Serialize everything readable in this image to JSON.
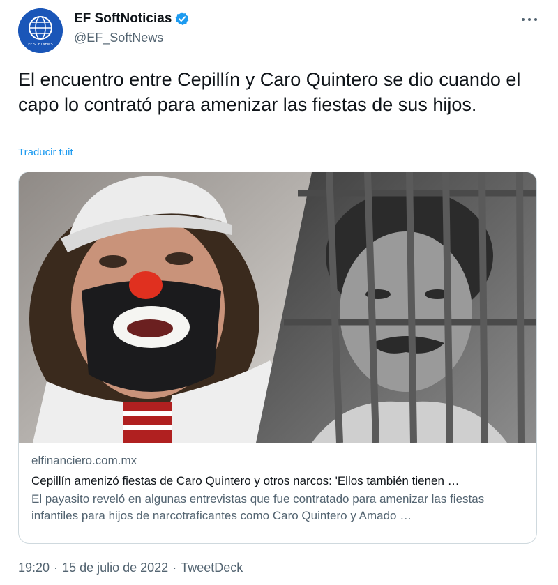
{
  "author": {
    "display_name": "EF SoftNoticias",
    "handle": "@EF_SoftNews",
    "avatar_icon": "globe-logo-icon",
    "avatar_text": "EF SOFTNEWS",
    "verified_icon": "verified-badge-icon"
  },
  "tweet": {
    "text": "El encuentro entre Cepillín y Caro Quintero se dio cuando el capo lo contrató para amenizar las fiestas de sus hijos.",
    "translate_label": "Traducir tuit"
  },
  "card": {
    "domain": "elfinanciero.com.mx",
    "title": "Cepillín amenizó fiestas de Caro Quintero y otros narcos: 'Ellos también tienen …",
    "description": "El payasito reveló en algunas entrevistas que fue contratado para amenizar las fiestas infantiles para hijos de narcotraficantes como Caro Quintero y Amado …"
  },
  "footer": {
    "time": "19:20",
    "sep1": "·",
    "date": "15 de julio de 2022",
    "sep2": "·",
    "source": "TweetDeck"
  },
  "colors": {
    "accent": "#1d9bf0",
    "text_primary": "#0f1419",
    "text_secondary": "#536471",
    "border": "#cfd9de",
    "avatar_bg": "#1a56b8"
  }
}
